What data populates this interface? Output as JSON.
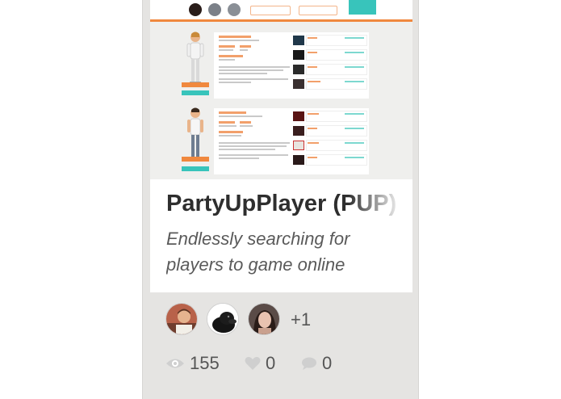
{
  "card": {
    "title": "PartyUpPlayer (PUP)",
    "tagline": "Endlessly searching for players to game online",
    "members": {
      "avatars": [
        "member-avatar-1",
        "member-avatar-2",
        "member-avatar-3"
      ],
      "more_count": "+1"
    },
    "stats": {
      "views": "155",
      "likes": "0",
      "comments": "0"
    }
  },
  "colors": {
    "accent_orange": "#f0883e",
    "accent_teal": "#38c4bb",
    "card_bg": "#e5e4e2"
  }
}
